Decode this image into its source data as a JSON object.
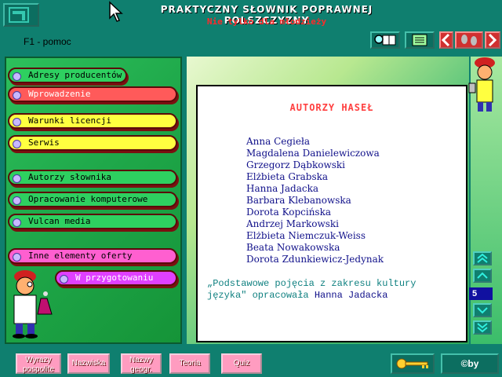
{
  "header": {
    "title": "PRAKTYCZNY SŁOWNIK POPRAWNEJ POLSZCZYZNY",
    "subtitle": "Nie tylko dla młodzieży",
    "help": "F1 - pomoc"
  },
  "menu": {
    "items": [
      {
        "label": "Adresy producentów"
      },
      {
        "label": "Wprowadzenie"
      },
      {
        "label": "Warunki licencji"
      },
      {
        "label": "Serwis"
      },
      {
        "label": "Autorzy słownika"
      },
      {
        "label": "Opracowanie komputerowe"
      },
      {
        "label": "Vulcan media"
      },
      {
        "label": "Inne elementy oferty"
      },
      {
        "label": "W przygotowaniu"
      }
    ]
  },
  "content": {
    "heading": "AUTORZY HASEŁ",
    "authors": [
      "Anna Cegieła",
      "Magdalena Danielewiczowa",
      "Grzegorz Dąbkowski",
      "Elżbieta Grabska",
      "Hanna Jadacka",
      "Barbara Klebanowska",
      "Dorota Kopcińska",
      "Andrzej Markowski",
      "Elżbieta Niemczuk-Weiss",
      "Beata Nowakowska",
      "Dorota Zdunkiewicz-Jedynak"
    ],
    "note_line1": "„Podstawowe pojęcia z zakresu kultury",
    "note_line2": "języka\" opracowała",
    "note_author": "Hanna Jadacka"
  },
  "pager": {
    "page": "5"
  },
  "bottom": {
    "buttons": [
      {
        "line1": "Wyrazy",
        "line2": "pospolite"
      },
      {
        "line1": "Nazwiska",
        "line2": ""
      },
      {
        "line1": "Nazwy",
        "line2": "geogr."
      },
      {
        "line1": "Teoria",
        "line2": ""
      },
      {
        "line1": "Quiz",
        "line2": ""
      }
    ],
    "copyright": "©by"
  },
  "colors": {
    "teal": "#0f7f6f",
    "accent_red": "#ff4040",
    "author_blue": "#10108a"
  }
}
